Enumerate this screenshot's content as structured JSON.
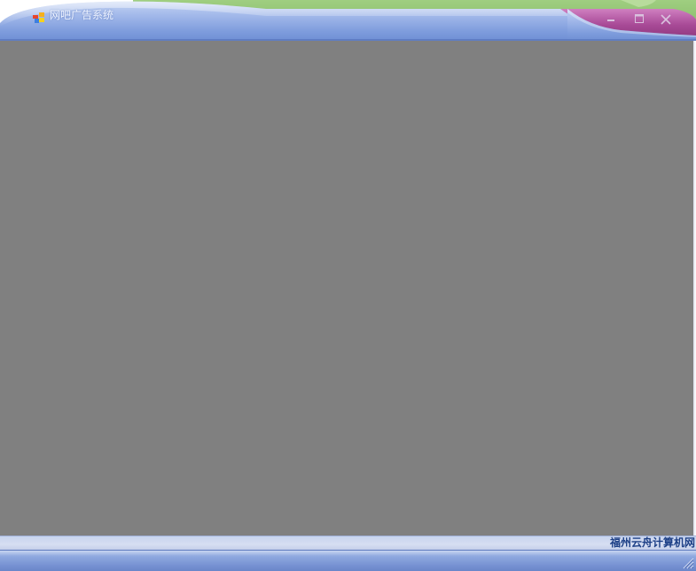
{
  "window": {
    "title": "网吧广告系统",
    "minimize_icon": "minimize-icon",
    "maximize_icon": "maximize-icon",
    "close_icon": "close-icon",
    "app_icon": "windows-flag-icon"
  },
  "client": {
    "background_color": "#808080"
  },
  "status": {
    "text": "福州云舟计算机网"
  },
  "bottom": {
    "grip_icon": "resize-grip-icon"
  },
  "colors": {
    "titlebar_blue": "#8aa6e0",
    "titlebar_green": "#8cc070",
    "accent_magenta": "#a2498f",
    "status_text": "#1c3f86"
  }
}
